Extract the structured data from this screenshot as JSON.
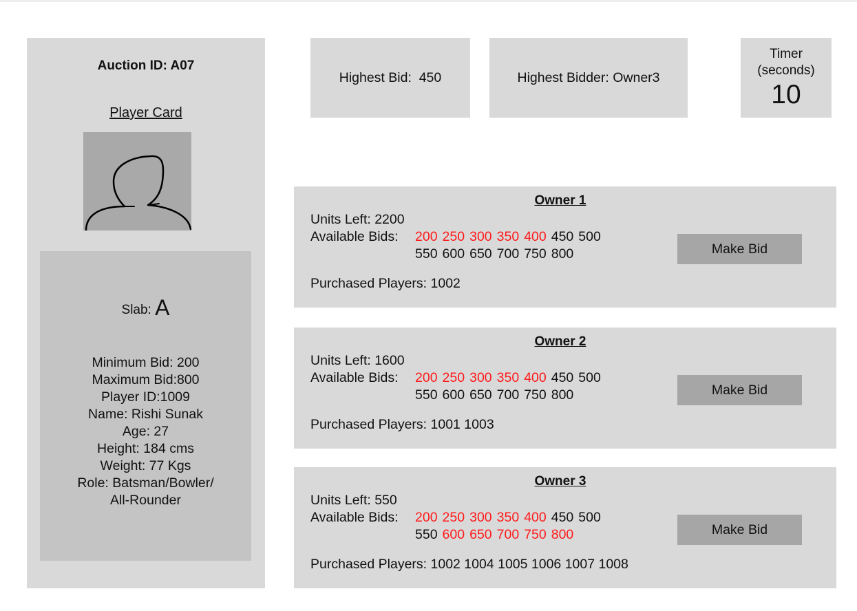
{
  "player_panel": {
    "auction_id_label": "Auction ID: ",
    "auction_id": "A07",
    "card_title": "Player Card",
    "avatar_icon": "player-silhouette-icon",
    "slab_label": "Slab: ",
    "slab_value": "A",
    "details": [
      "Minimum Bid: 200",
      "Maximum Bid:800",
      "Player ID:1009",
      "Name: Rishi Sunak",
      "Age: 27",
      "Height: 184 cms",
      "Weight: 77 Kgs",
      "Role: Batsman/Bowler/",
      "All-Rounder"
    ]
  },
  "stats": {
    "highest_bid": "Highest Bid:  450",
    "highest_bidder": "Highest Bidder: Owner3",
    "timer_label_1": "Timer",
    "timer_label_2": "(seconds)",
    "timer_value": "10"
  },
  "colors": {
    "panel_bg": "#d9d9d9",
    "details_bg": "#c4c4c4",
    "avatar_bg": "#a9a9a9",
    "button_bg": "#a6a6a6",
    "used_bid": "#ff1a1a"
  },
  "owners": [
    {
      "title": "Owner 1",
      "units_left": "Units Left: 2200",
      "bids_label": "Available Bids:",
      "bids_row1": [
        {
          "value": "200",
          "used": true
        },
        {
          "value": "250",
          "used": true
        },
        {
          "value": "300",
          "used": true
        },
        {
          "value": "350",
          "used": true
        },
        {
          "value": "400",
          "used": true
        },
        {
          "value": "450",
          "used": false
        },
        {
          "value": "500",
          "used": false
        }
      ],
      "bids_row2": [
        {
          "value": "550",
          "used": false
        },
        {
          "value": "600",
          "used": false
        },
        {
          "value": "650",
          "used": false
        },
        {
          "value": "700",
          "used": false
        },
        {
          "value": "750",
          "used": false
        },
        {
          "value": "800",
          "used": false
        }
      ],
      "purchased": "Purchased Players: 1002",
      "button_label": "Make Bid"
    },
    {
      "title": "Owner 2",
      "units_left": "Units Left: 1600",
      "bids_label": "Available Bids:",
      "bids_row1": [
        {
          "value": "200",
          "used": true
        },
        {
          "value": "250",
          "used": true
        },
        {
          "value": "300",
          "used": true
        },
        {
          "value": "350",
          "used": true
        },
        {
          "value": "400",
          "used": true
        },
        {
          "value": "450",
          "used": false
        },
        {
          "value": "500",
          "used": false
        }
      ],
      "bids_row2": [
        {
          "value": "550",
          "used": false
        },
        {
          "value": "600",
          "used": false
        },
        {
          "value": "650",
          "used": false
        },
        {
          "value": "700",
          "used": false
        },
        {
          "value": "750",
          "used": false
        },
        {
          "value": "800",
          "used": false
        }
      ],
      "purchased": "Purchased Players: 1001 1003",
      "button_label": "Make Bid"
    },
    {
      "title": "Owner 3",
      "units_left": "Units Left: 550",
      "bids_label": "Available Bids:",
      "bids_row1": [
        {
          "value": "200",
          "used": true
        },
        {
          "value": "250",
          "used": true
        },
        {
          "value": "300",
          "used": true
        },
        {
          "value": "350",
          "used": true
        },
        {
          "value": "400",
          "used": true
        },
        {
          "value": "450",
          "used": false
        },
        {
          "value": "500",
          "used": false
        }
      ],
      "bids_row2": [
        {
          "value": "550",
          "used": false
        },
        {
          "value": "600",
          "used": true
        },
        {
          "value": "650",
          "used": true
        },
        {
          "value": "700",
          "used": true
        },
        {
          "value": "750",
          "used": true
        },
        {
          "value": "800",
          "used": true
        }
      ],
      "purchased": "Purchased Players: 1002 1004 1005 1006 1007 1008",
      "button_label": "Make Bid"
    }
  ]
}
